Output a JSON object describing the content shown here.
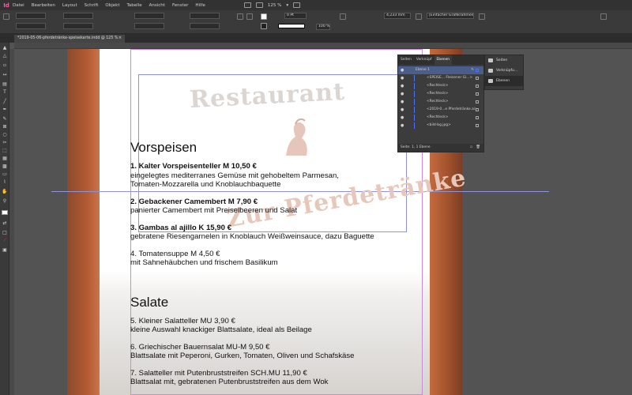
{
  "app": {
    "logo": "Id",
    "menu": [
      "Datei",
      "Bearbeiten",
      "Layout",
      "Schrift",
      "Objekt",
      "Tabelle",
      "Ansicht",
      "Fenster",
      "Hilfe"
    ],
    "zoom": "125 %"
  },
  "control_bar": {
    "stroke_weight": "0 Pt",
    "width_mm": "4,233 mm",
    "opacity": "100 %",
    "frame_style": "[Einfacher Grafikrahmen]+"
  },
  "document_tab": {
    "title": "*2019-05-06-pferdetränke-speisekarte.indd @ 125 %",
    "close": "×"
  },
  "page": {
    "watermark_title": "Restaurant",
    "watermark_subtitle": "Zur Pferdetränke",
    "sections": [
      {
        "heading": "Vorspeisen",
        "items": [
          {
            "title": "1. Kalter Vorspeisenteller M 10,50 €",
            "desc": [
              "eingelegtes mediterranes Gemüse mit gehobeltem Parmesan,",
              "Tomaten-Mozzarella und Knoblauchbaquette"
            ],
            "bold": true
          },
          {
            "title": "2. Gebackener Camembert M 7,90 €",
            "desc": [
              "panierter Camembert mit Preiselbeeren und Salat"
            ],
            "bold": true
          },
          {
            "title": "3. Gambas al ajillo K 15,90 €",
            "desc": [
              "gebratene Riesengarnelen in Knoblauch Weißweinsauce, dazu Baguette"
            ],
            "bold": true
          },
          {
            "title": "4. Tomatensuppe M 4,50 €",
            "desc": [
              "mit Sahnehäubchen und frischem Basilikum"
            ],
            "bold": false
          }
        ]
      },
      {
        "heading": "Salate",
        "items": [
          {
            "title": "5. Kleiner Salatteller MU 3,90 €",
            "desc": [
              "kleine Auswahl knackiger Blattsalate, ideal als Beilage"
            ],
            "bold": false
          },
          {
            "title": "6. Griechischer Bauernsalat MU-M 9,50 €",
            "desc": [
              "Blattsalate mit Peperoni, Gurken, Tomaten, Oliven und Schafskäse"
            ],
            "bold": false
          },
          {
            "title": "7. Salatteller mit Putenbruststreifen SCH.MU 11,90 €",
            "desc": [
              "Blattsalat mit, gebratenen Putenbruststreifen aus dem Wok"
            ],
            "bold": false
          }
        ]
      }
    ]
  },
  "layers_panel": {
    "tabs": [
      "Seiten",
      "Verknüpf",
      "Ebenen"
    ],
    "active_tab": "Ebenen",
    "layer": "Ebene 1",
    "rows": [
      "<SPEISE... Fleisener Gi...>",
      "<Rechteck>",
      "<Rechteck>",
      "<Rechteck>",
      "<2019-0...e Pferdetränke.ai>",
      "<Rechteck>",
      "<bild-bg.jpg>"
    ],
    "footer": "Seite: 1, 1 Ebene"
  },
  "right_panel": {
    "items": [
      "Seiten",
      "Verknüpfu...",
      "Ebenen"
    ],
    "active": "Ebenen"
  },
  "colors": {
    "accent": "#4a74ff",
    "bleed": "#b35a33",
    "logo": "#ff5aa5"
  }
}
